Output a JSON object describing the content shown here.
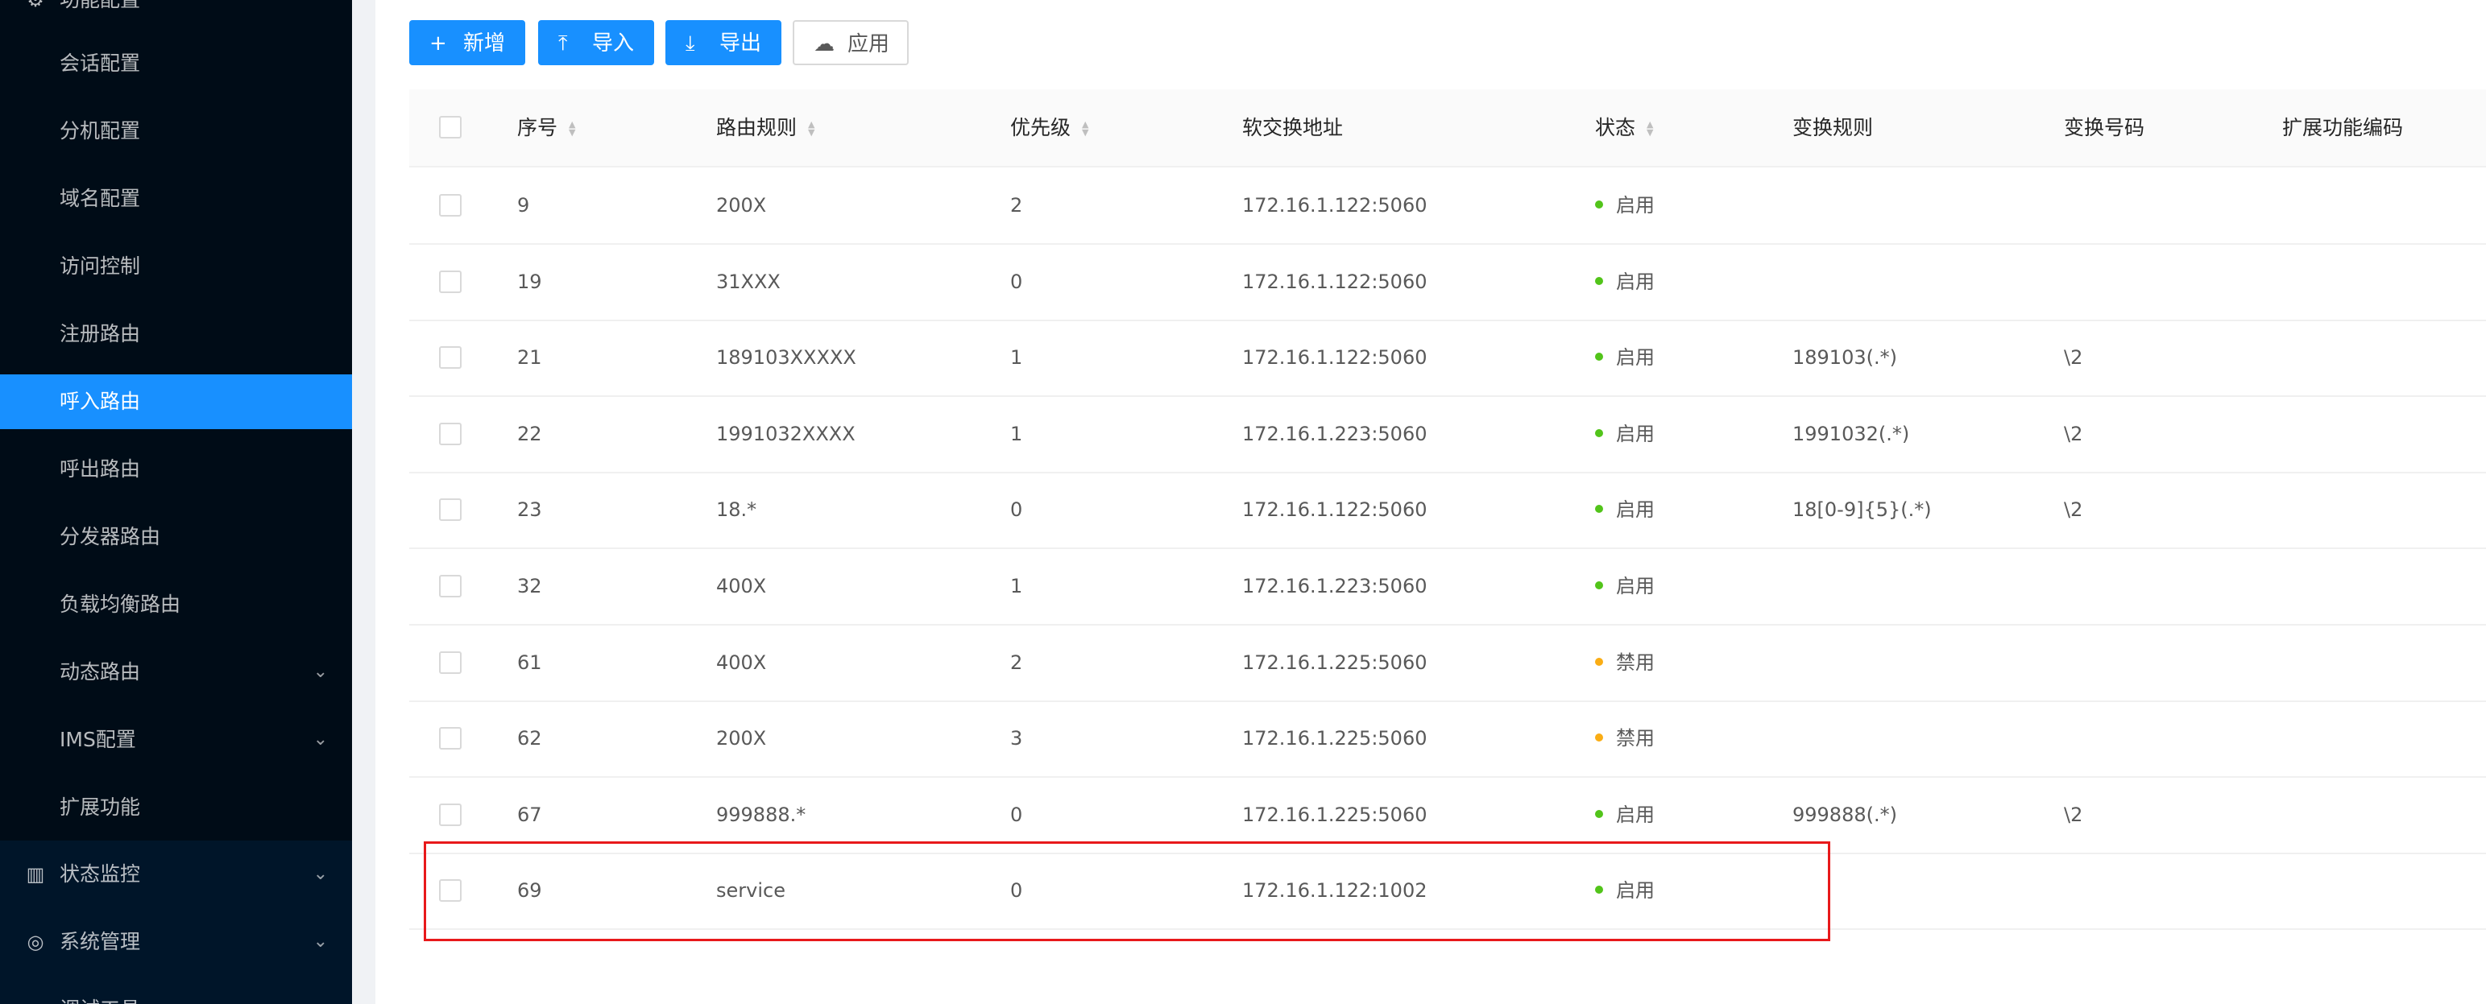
{
  "sidebar": {
    "group_label": "功能配置",
    "items": [
      {
        "label": "会话配置"
      },
      {
        "label": "分机配置"
      },
      {
        "label": "域名配置"
      },
      {
        "label": "访问控制"
      },
      {
        "label": "注册路由"
      },
      {
        "label": "呼入路由",
        "active": true
      },
      {
        "label": "呼出路由"
      },
      {
        "label": "分发器路由"
      },
      {
        "label": "负载均衡路由"
      },
      {
        "label": "动态路由",
        "chevron": "chevron-down-icon"
      },
      {
        "label": "IMS配置",
        "chevron": "chevron-down-icon"
      },
      {
        "label": "扩展功能"
      }
    ],
    "top_items": [
      {
        "label": "状态监控",
        "icon": "bar-chart-icon"
      },
      {
        "label": "系统管理",
        "icon": "location-pin-icon"
      },
      {
        "label": "调试工具"
      }
    ]
  },
  "toolbar": {
    "add_label": "新增",
    "import_label": "导入",
    "export_label": "导出",
    "apply_label": "应用"
  },
  "table": {
    "columns": [
      "序号",
      "路由规则",
      "优先级",
      "软交换地址",
      "状态",
      "变换规则",
      "变换号码",
      "扩展功能编码"
    ],
    "rows": [
      {
        "id": "9",
        "rule": "200X",
        "priority": "2",
        "address": "172.16.1.122:5060",
        "status": "启用",
        "transform": "",
        "number": ""
      },
      {
        "id": "19",
        "rule": "31XXX",
        "priority": "0",
        "address": "172.16.1.122:5060",
        "status": "启用",
        "transform": "",
        "number": ""
      },
      {
        "id": "21",
        "rule": "189103XXXXX",
        "priority": "1",
        "address": "172.16.1.122:5060",
        "status": "启用",
        "transform": "189103(.*)",
        "number": "\\2"
      },
      {
        "id": "22",
        "rule": "1991032XXXX",
        "priority": "1",
        "address": "172.16.1.223:5060",
        "status": "启用",
        "transform": "1991032(.*)",
        "number": "\\2"
      },
      {
        "id": "23",
        "rule": "18.*",
        "priority": "0",
        "address": "172.16.1.122:5060",
        "status": "启用",
        "transform": "18[0-9]{5}(.*)",
        "number": "\\2"
      },
      {
        "id": "32",
        "rule": "400X",
        "priority": "1",
        "address": "172.16.1.223:5060",
        "status": "启用",
        "transform": "",
        "number": ""
      },
      {
        "id": "61",
        "rule": "400X",
        "priority": "2",
        "address": "172.16.1.225:5060",
        "status": "禁用",
        "transform": "",
        "number": ""
      },
      {
        "id": "62",
        "rule": "200X",
        "priority": "3",
        "address": "172.16.1.225:5060",
        "status": "禁用",
        "transform": "",
        "number": ""
      },
      {
        "id": "67",
        "rule": "999888.*",
        "priority": "0",
        "address": "172.16.1.225:5060",
        "status": "启用",
        "transform": "999888(.*)",
        "number": "\\2"
      },
      {
        "id": "69",
        "rule": "service",
        "priority": "0",
        "address": "172.16.1.122:1002",
        "status": "启用",
        "transform": "",
        "number": ""
      }
    ]
  },
  "colors": {
    "primary": "#1890ff",
    "enabled": "#52c41a",
    "disabled": "#faad14",
    "highlight": "#e8191b",
    "sidebar_bg": "#001529"
  }
}
